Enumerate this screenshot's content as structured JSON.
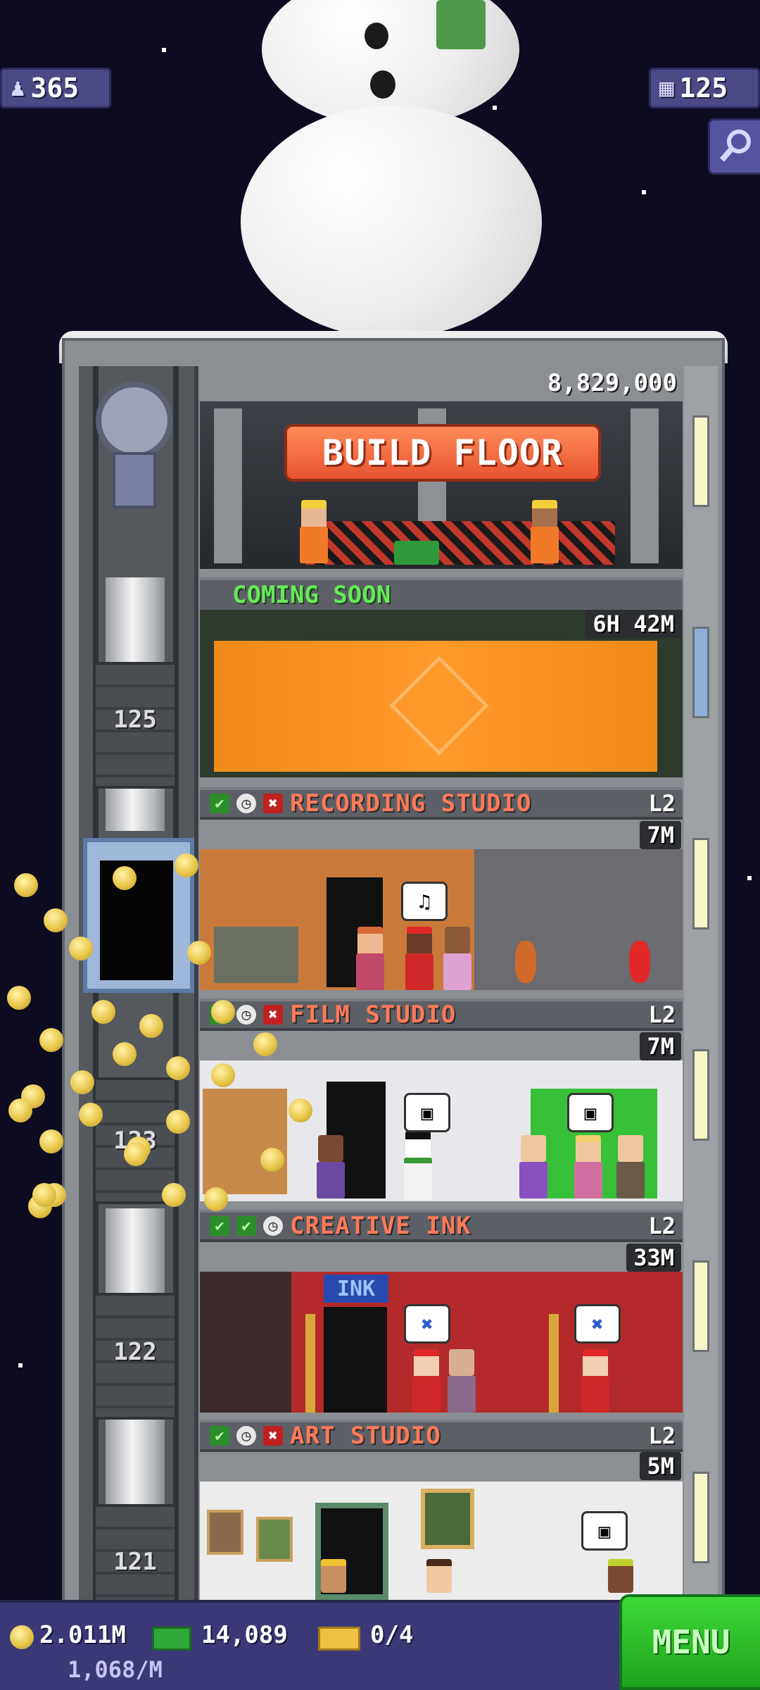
{
  "hud": {
    "residents": "365",
    "floors": "125"
  },
  "build_floor": {
    "price": "8,829,000",
    "button_label": "BUILD FLOOR"
  },
  "coming_soon": {
    "label": "COMING SOON",
    "timer": "6H 42M"
  },
  "floors": [
    {
      "name": "RECORDING STUDIO",
      "level": "L2",
      "timer": "7M",
      "status": [
        "check",
        "clock",
        "x"
      ]
    },
    {
      "name": "FILM STUDIO",
      "level": "L2",
      "timer": "7M",
      "status": [
        "check",
        "clock",
        "x"
      ]
    },
    {
      "name": "CREATIVE INK",
      "level": "L2",
      "timer": "33M",
      "status": [
        "check",
        "check",
        "clock"
      ]
    },
    {
      "name": "ART STUDIO",
      "level": "L2",
      "timer": "5M",
      "status": [
        "check",
        "clock",
        "x"
      ]
    }
  ],
  "shaft_numbers": [
    "125",
    "123",
    "122",
    "121"
  ],
  "room_props": {
    "ink_sign": "INK",
    "music_note": "♫"
  },
  "bottom_bar": {
    "coins": "2.011M",
    "coins_rate": "1,068/M",
    "bux": "14,089",
    "tickets": "0/4",
    "menu_label": "MENU"
  },
  "icons": {
    "residents": "person-icon",
    "floors": "building-icon",
    "search": "magnifier-icon",
    "coin": "coin-icon",
    "bux": "banknote-icon",
    "ticket": "ticket-icon"
  },
  "colors": {
    "sky": "#0c0b1f",
    "hud_badge": "#4c4a86",
    "build_button": "#e7542f",
    "menu_button": "#1ea21c",
    "floor_name": "#ff7a5a",
    "coming_soon": "#68e85a"
  }
}
